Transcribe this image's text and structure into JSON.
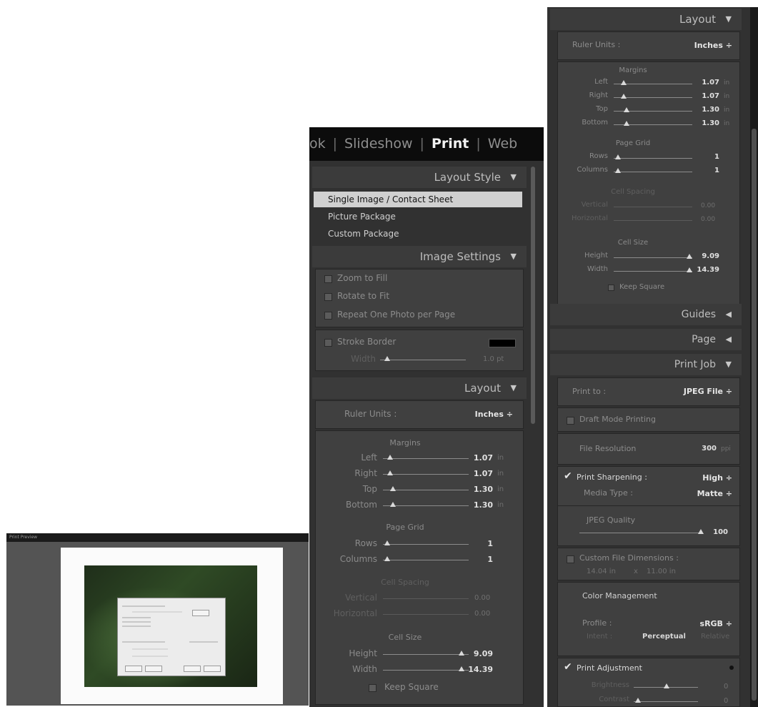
{
  "modules": {
    "partial": "ok",
    "slideshow": "Slideshow",
    "print": "Print",
    "web": "Web"
  },
  "layout_style": {
    "header": "Layout Style",
    "options": [
      "Single Image / Contact Sheet",
      "Picture Package",
      "Custom Package"
    ],
    "selected_index": 0
  },
  "image_settings": {
    "header": "Image Settings",
    "zoom_to_fill": "Zoom to Fill",
    "rotate_to_fit": "Rotate to Fit",
    "repeat_one": "Repeat One Photo per Page",
    "stroke_border": "Stroke Border",
    "width_label": "Width",
    "width_value": "1.0 pt",
    "stroke_color": "#000000"
  },
  "layout": {
    "header": "Layout",
    "ruler_units_label": "Ruler Units :",
    "ruler_units_value": "Inches ÷",
    "margins_title": "Margins",
    "left": "Left",
    "right": "Right",
    "top": "Top",
    "bottom": "Bottom",
    "left_value": "1.07",
    "right_value": "1.07",
    "top_value": "1.30",
    "bottom_value": "1.30",
    "unit": "in",
    "page_grid_title": "Page Grid",
    "rows": "Rows",
    "columns": "Columns",
    "rows_value": "1",
    "columns_value": "1",
    "cell_spacing_title": "Cell Spacing",
    "vertical": "Vertical",
    "horizontal": "Horizontal",
    "vertical_value": "0.00",
    "horizontal_value": "0.00",
    "cell_size_title": "Cell Size",
    "height": "Height",
    "width": "Width",
    "height_value": "9.09",
    "width_value": "14.39",
    "keep_square": "Keep Square"
  },
  "guides": {
    "header": "Guides"
  },
  "page": {
    "header": "Page"
  },
  "print_job": {
    "header": "Print Job",
    "print_to_label": "Print to :",
    "print_to_value": "JPEG File ÷",
    "draft_mode": "Draft Mode Printing",
    "file_resolution_label": "File Resolution",
    "file_resolution_value": "300",
    "file_resolution_unit": "ppi",
    "print_sharpening": "Print Sharpening :",
    "sharpening_value": "High ÷",
    "media_type_label": "Media Type :",
    "media_type_value": "Matte ÷",
    "jpeg_quality_label": "JPEG Quality",
    "jpeg_quality_value": "100",
    "custom_file_dimensions": "Custom File Dimensions :",
    "dim_w": "14.04 in",
    "dim_x": "x",
    "dim_h": "11.00 in",
    "color_management": "Color Management",
    "profile_label": "Profile :",
    "profile_value": "sRGB ÷",
    "intent_label": "Intent :",
    "intent_perceptual": "Perceptual",
    "intent_relative": "Relative",
    "print_adjustment": "Print Adjustment",
    "brightness": "Brightness",
    "contrast": "Contrast",
    "brightness_value": "0",
    "contrast_value": "0"
  },
  "preview": {
    "title": "Print Preview"
  }
}
